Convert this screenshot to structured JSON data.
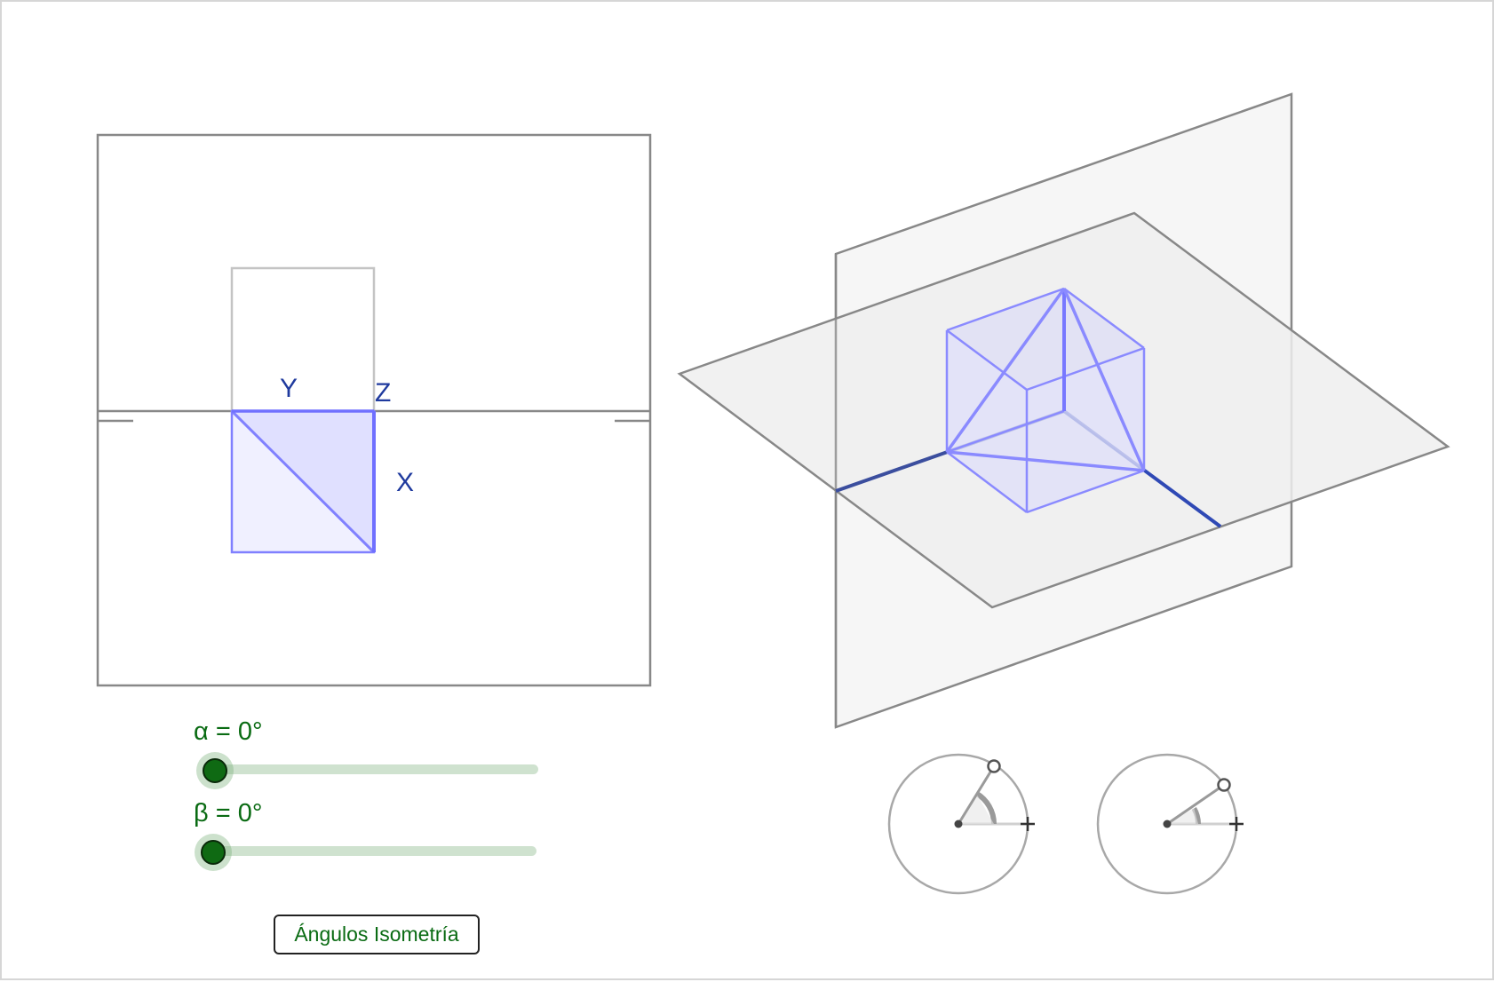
{
  "labels": {
    "axis_y": "Y",
    "axis_z": "Z",
    "axis_x": "X"
  },
  "sliders": [
    {
      "label": "α = 0°",
      "value": 0,
      "unit": "°"
    },
    {
      "label": "β = 0°",
      "value": 0,
      "unit": "°"
    }
  ],
  "button": {
    "label": "Ángulos Isometría"
  },
  "colors": {
    "frame_gray": "#888888",
    "cube_stroke": "#8080ff",
    "cube_fill": "#e2e2ff",
    "axis_blue": "#1f3a9e",
    "slider_green": "#0a6b13",
    "slider_track": "#cfe2cf",
    "plane_fill": "#f5f5f5"
  },
  "icons": [
    "angle-dial-icon",
    "angle-dial-icon"
  ]
}
